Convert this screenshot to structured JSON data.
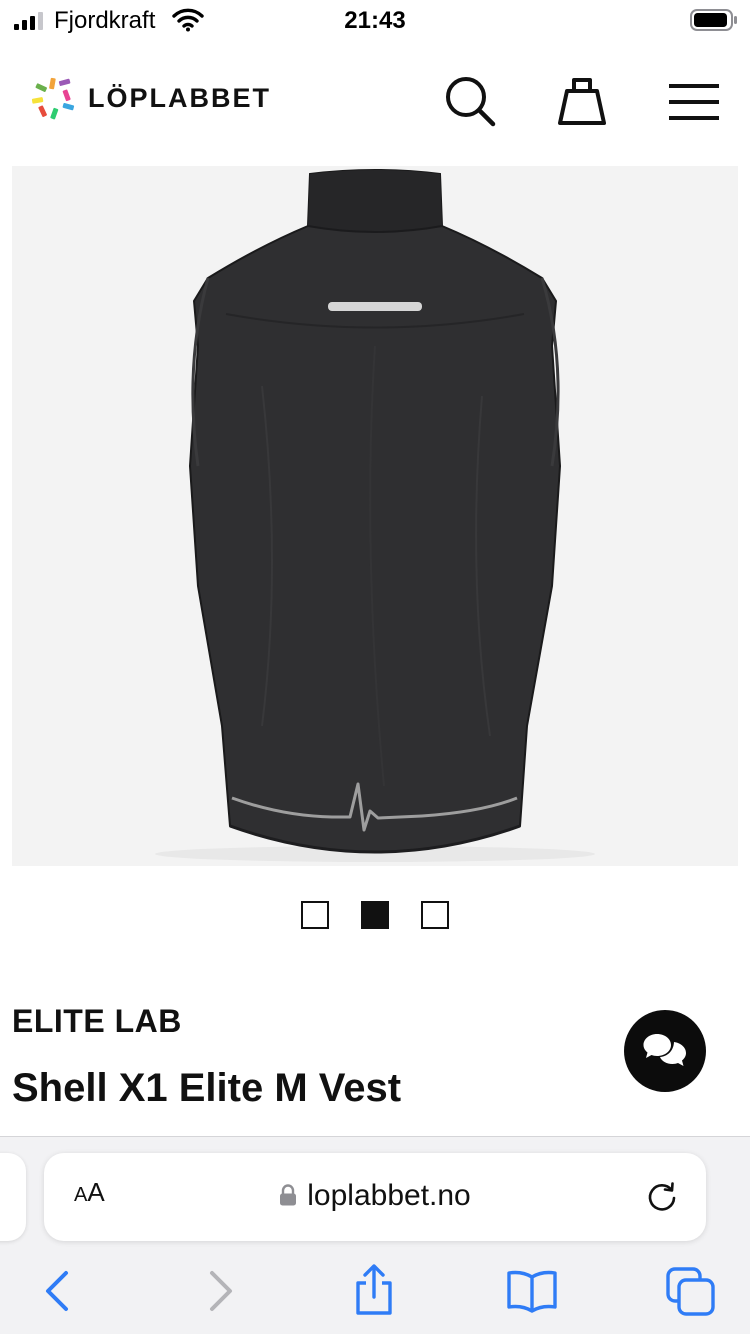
{
  "status_bar": {
    "carrier": "Fjordkraft",
    "time": "21:43"
  },
  "header": {
    "logo_text": "LÖPLABBET",
    "icons": [
      "search-icon",
      "shopping-bag-icon",
      "hamburger-menu-icon"
    ]
  },
  "product": {
    "image_label": "black running vest, back view",
    "gallery_count": 3,
    "gallery_active_index": 1,
    "brand": "ELITE LAB",
    "name": "Shell X1 Elite M Vest"
  },
  "safari": {
    "aa_label": "AA",
    "url": "loplabbet.no",
    "icons": [
      "lock-icon",
      "reload-icon",
      "back-icon",
      "forward-icon",
      "share-icon",
      "bookmarks-icon",
      "tabs-icon"
    ]
  },
  "colors": {
    "accent": "#111111",
    "nav_blue": "#2f7cf6",
    "nav_disabled": "#b4b4b8"
  }
}
